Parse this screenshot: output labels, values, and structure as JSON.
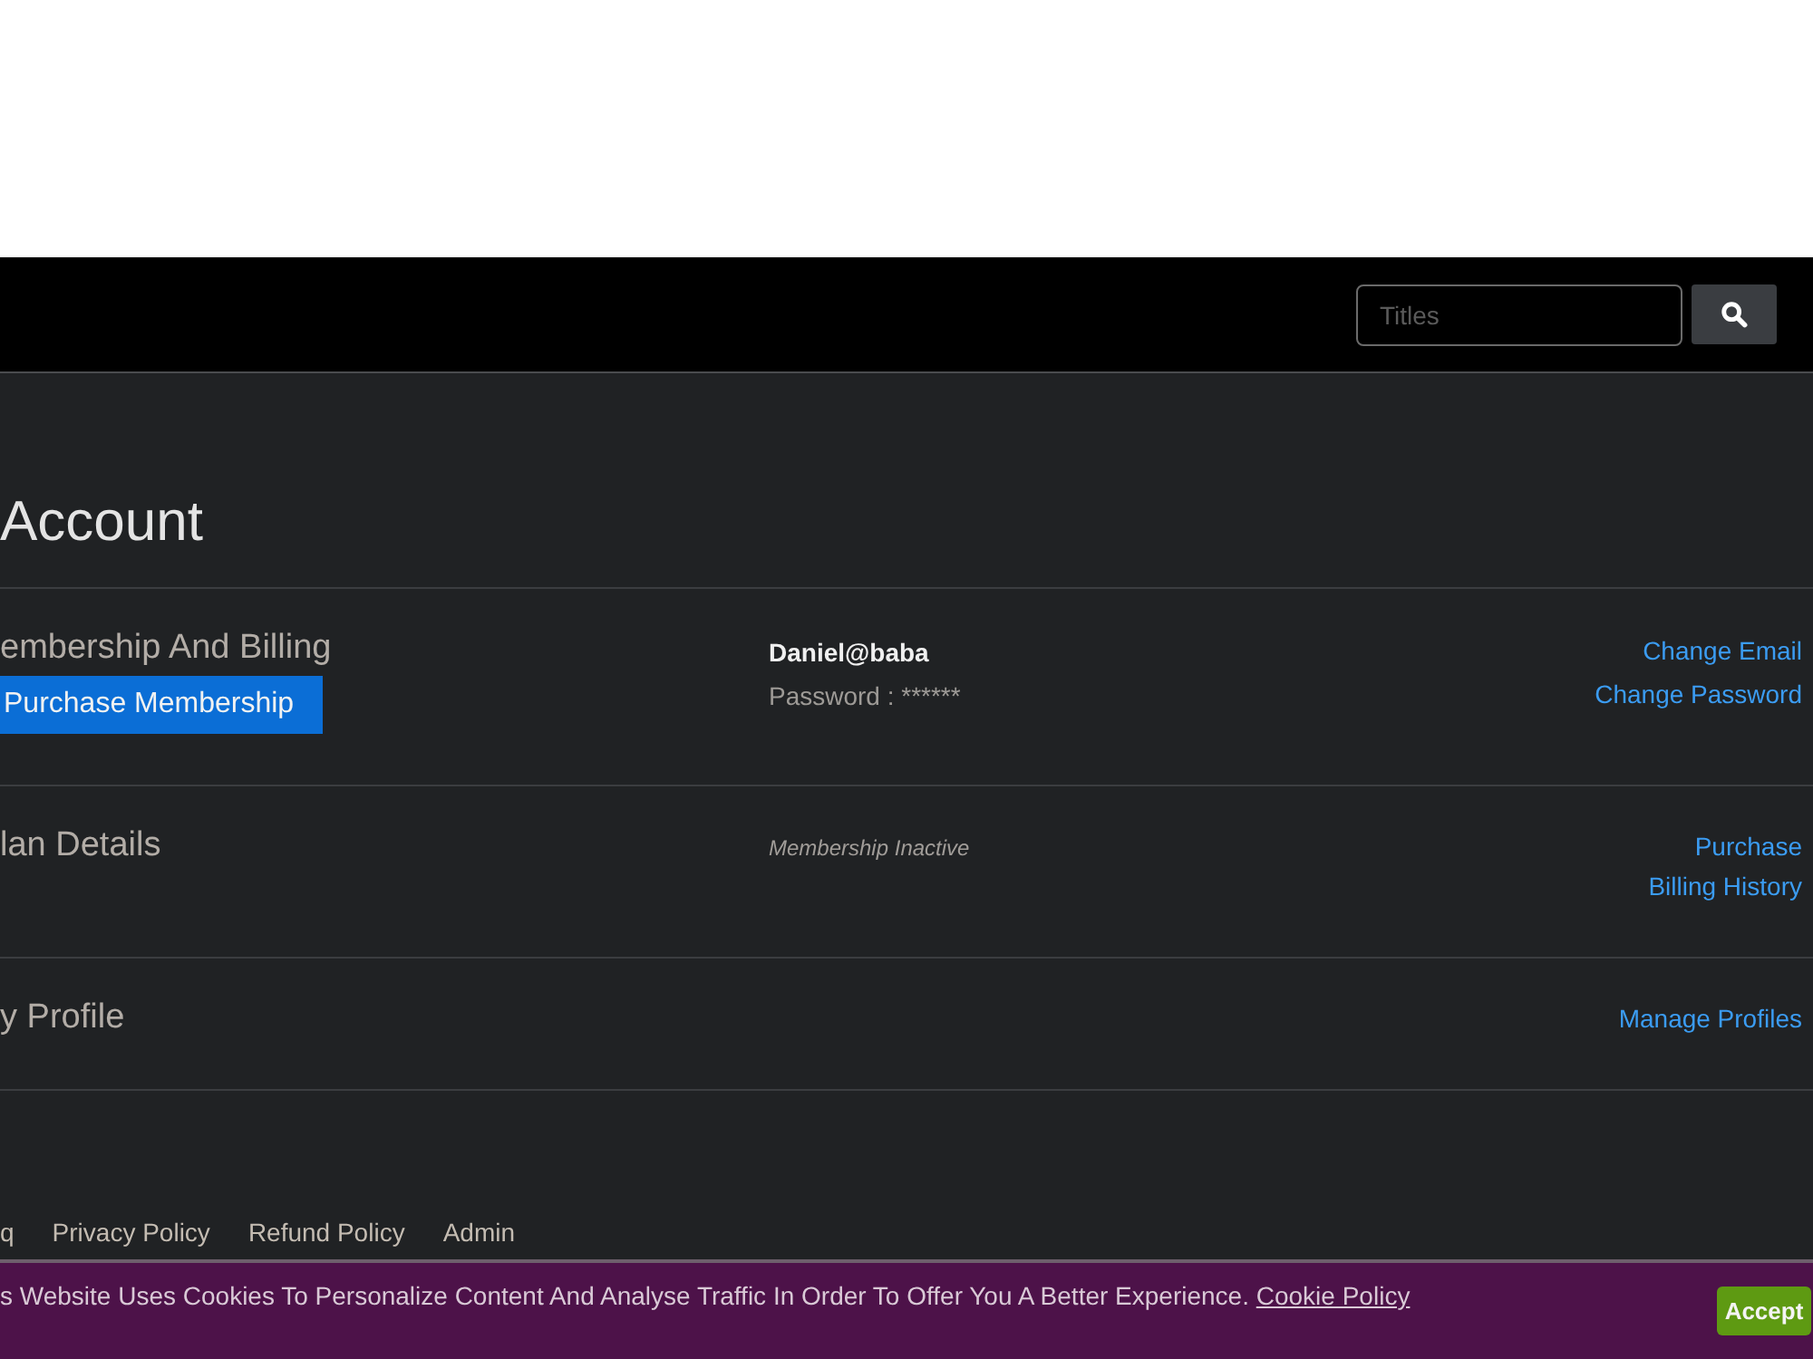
{
  "navbar": {
    "search": {
      "placeholder": "Titles"
    }
  },
  "page_title": "Account",
  "sections": [
    {
      "heading": "embership And Billing",
      "button": "Purchase Membership",
      "info": [
        {
          "kind": "email",
          "text": "Daniel@baba"
        },
        {
          "kind": "password",
          "text": "Password : ******"
        }
      ],
      "links": [
        "Change Email",
        "Change Password"
      ]
    },
    {
      "heading": "lan Details",
      "info": [
        {
          "kind": "status",
          "text": "Membership Inactive"
        }
      ],
      "links": [
        "Purchase",
        "Billing History"
      ]
    },
    {
      "heading": "y Profile",
      "links": [
        "Manage Profiles"
      ]
    }
  ],
  "footer_links": [
    "q",
    "Privacy Policy",
    "Refund Policy",
    "Admin"
  ],
  "cookie_banner": {
    "message": "s Website Uses Cookies To Personalize Content And Analyse Traffic In Order To Offer You A Better Experience. ",
    "link": "Cookie Policy",
    "button": "Accept"
  }
}
